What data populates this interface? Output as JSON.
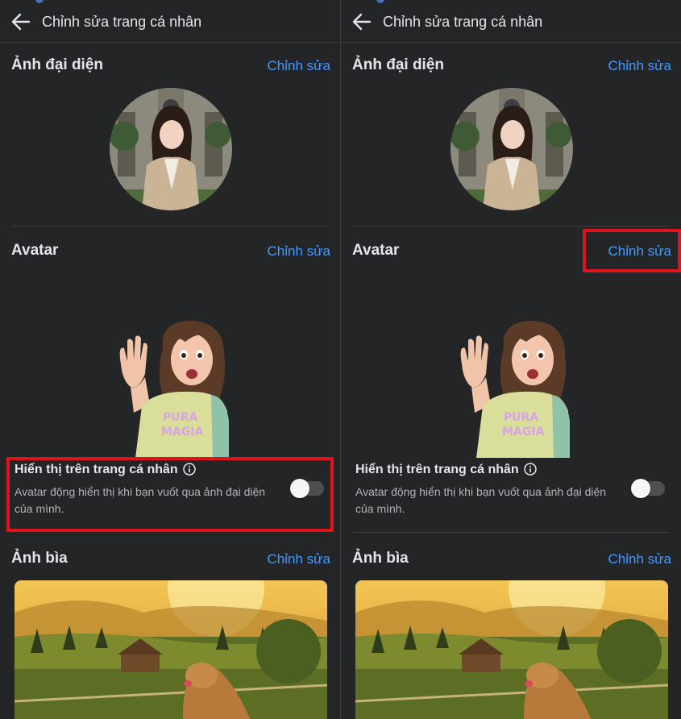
{
  "panels": [
    {
      "header": {
        "title": "Chỉnh sửa trang cá nhân"
      },
      "profile_photo": {
        "title": "Ảnh đại diện",
        "edit_label": "Chỉnh sửa"
      },
      "avatar": {
        "title": "Avatar",
        "edit_label": "Chỉnh sửa",
        "toggle_title": "Hiển thị trên trang cá nhân",
        "toggle_desc": "Avatar động hiển thị khi bạn vuốt qua ảnh đại diện của mình.",
        "toggle_on": false
      },
      "cover_photo": {
        "title": "Ảnh bìa",
        "edit_label": "Chỉnh sửa"
      }
    },
    {
      "header": {
        "title": "Chỉnh sửa trang cá nhân"
      },
      "profile_photo": {
        "title": "Ảnh đại diện",
        "edit_label": "Chỉnh sửa"
      },
      "avatar": {
        "title": "Avatar",
        "edit_label": "Chỉnh sửa",
        "toggle_title": "Hiển thị trên trang cá nhân",
        "toggle_desc": "Avatar động hiển thị khi bạn vuốt qua ảnh đại diện của mình.",
        "toggle_on": false
      },
      "cover_photo": {
        "title": "Ảnh bìa",
        "edit_label": "Chỉnh sửa"
      }
    }
  ],
  "colors": {
    "background": "#242526",
    "link": "#4599ff",
    "highlight": "#e0121c"
  },
  "icons": [
    "back-arrow-icon",
    "info-icon"
  ]
}
